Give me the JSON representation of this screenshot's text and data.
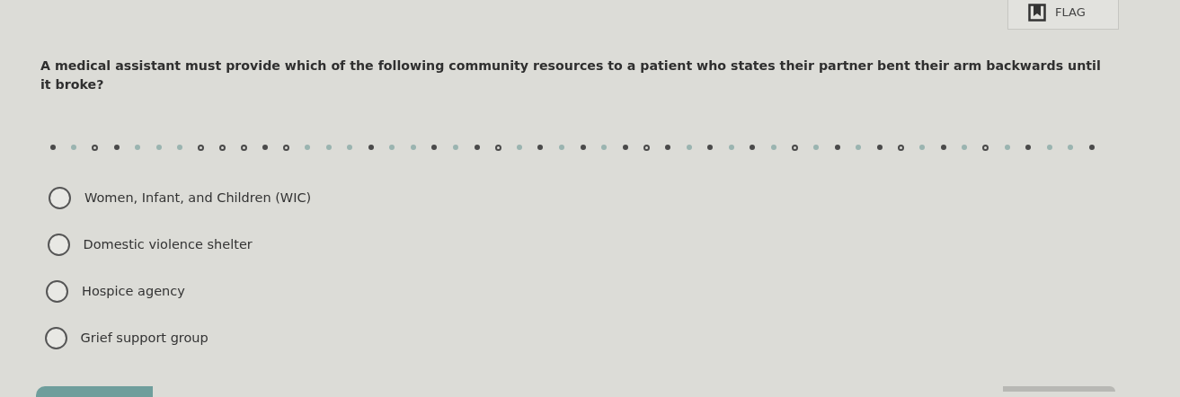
{
  "flag_button": {
    "label": "FLAG"
  },
  "question": {
    "text": "A medical assistant must provide which of the following community resources to a patient who states their partner bent their arm backwards until it broke?"
  },
  "progress_dots": [
    {
      "kind": "filled"
    },
    {
      "kind": "pale"
    },
    {
      "kind": "ring"
    },
    {
      "kind": "filled"
    },
    {
      "kind": "pale"
    },
    {
      "kind": "pale"
    },
    {
      "kind": "pale"
    },
    {
      "kind": "ring"
    },
    {
      "kind": "ring"
    },
    {
      "kind": "ring"
    },
    {
      "kind": "filled"
    },
    {
      "kind": "ring"
    },
    {
      "kind": "pale"
    },
    {
      "kind": "pale"
    },
    {
      "kind": "pale"
    },
    {
      "kind": "filled"
    },
    {
      "kind": "pale"
    },
    {
      "kind": "pale"
    },
    {
      "kind": "filled"
    },
    {
      "kind": "pale"
    },
    {
      "kind": "filled"
    },
    {
      "kind": "ring"
    },
    {
      "kind": "pale"
    },
    {
      "kind": "filled"
    },
    {
      "kind": "pale"
    },
    {
      "kind": "filled"
    },
    {
      "kind": "pale"
    },
    {
      "kind": "filled"
    },
    {
      "kind": "ring"
    },
    {
      "kind": "filled"
    },
    {
      "kind": "pale"
    },
    {
      "kind": "filled"
    },
    {
      "kind": "pale"
    },
    {
      "kind": "filled"
    },
    {
      "kind": "pale"
    },
    {
      "kind": "ring"
    },
    {
      "kind": "pale"
    },
    {
      "kind": "filled"
    },
    {
      "kind": "pale"
    },
    {
      "kind": "filled"
    },
    {
      "kind": "ring"
    },
    {
      "kind": "pale"
    },
    {
      "kind": "filled"
    },
    {
      "kind": "pale"
    },
    {
      "kind": "ring"
    },
    {
      "kind": "pale"
    },
    {
      "kind": "filled"
    },
    {
      "kind": "pale"
    },
    {
      "kind": "pale"
    },
    {
      "kind": "filled"
    }
  ],
  "options": [
    {
      "label": "Women, Infant, and Children (WIC)",
      "selected": false
    },
    {
      "label": "Domestic violence shelter",
      "selected": false
    },
    {
      "label": "Hospice agency",
      "selected": false
    },
    {
      "label": "Grief support group",
      "selected": false
    }
  ]
}
